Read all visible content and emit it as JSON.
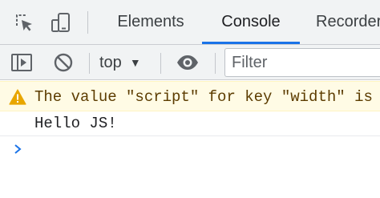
{
  "devtools": {
    "tabs": [
      {
        "label": "Elements"
      },
      {
        "label": "Console"
      },
      {
        "label": "Recorder"
      }
    ],
    "active_tab": "Console",
    "accent_color": "#1a73e8"
  },
  "toolbar": {
    "context_label": "top",
    "context_caret": "▼",
    "filter_placeholder": "Filter"
  },
  "icons": {
    "inspect": "inspect-element-icon",
    "device": "device-toolbar-icon",
    "sidebar": "console-sidebar-icon",
    "clear": "clear-console-icon",
    "live_expression": "eye-icon",
    "warning": "warning-icon",
    "prompt": "prompt-chevron-icon"
  },
  "console": {
    "messages": [
      {
        "level": "warning",
        "text": "The value \"script\" for key \"width\" is invalid, and has been ignored."
      },
      {
        "level": "log",
        "text": "Hello JS!"
      }
    ],
    "warning_bg": "#fffbe5",
    "warning_fg": "#5c3c00"
  }
}
